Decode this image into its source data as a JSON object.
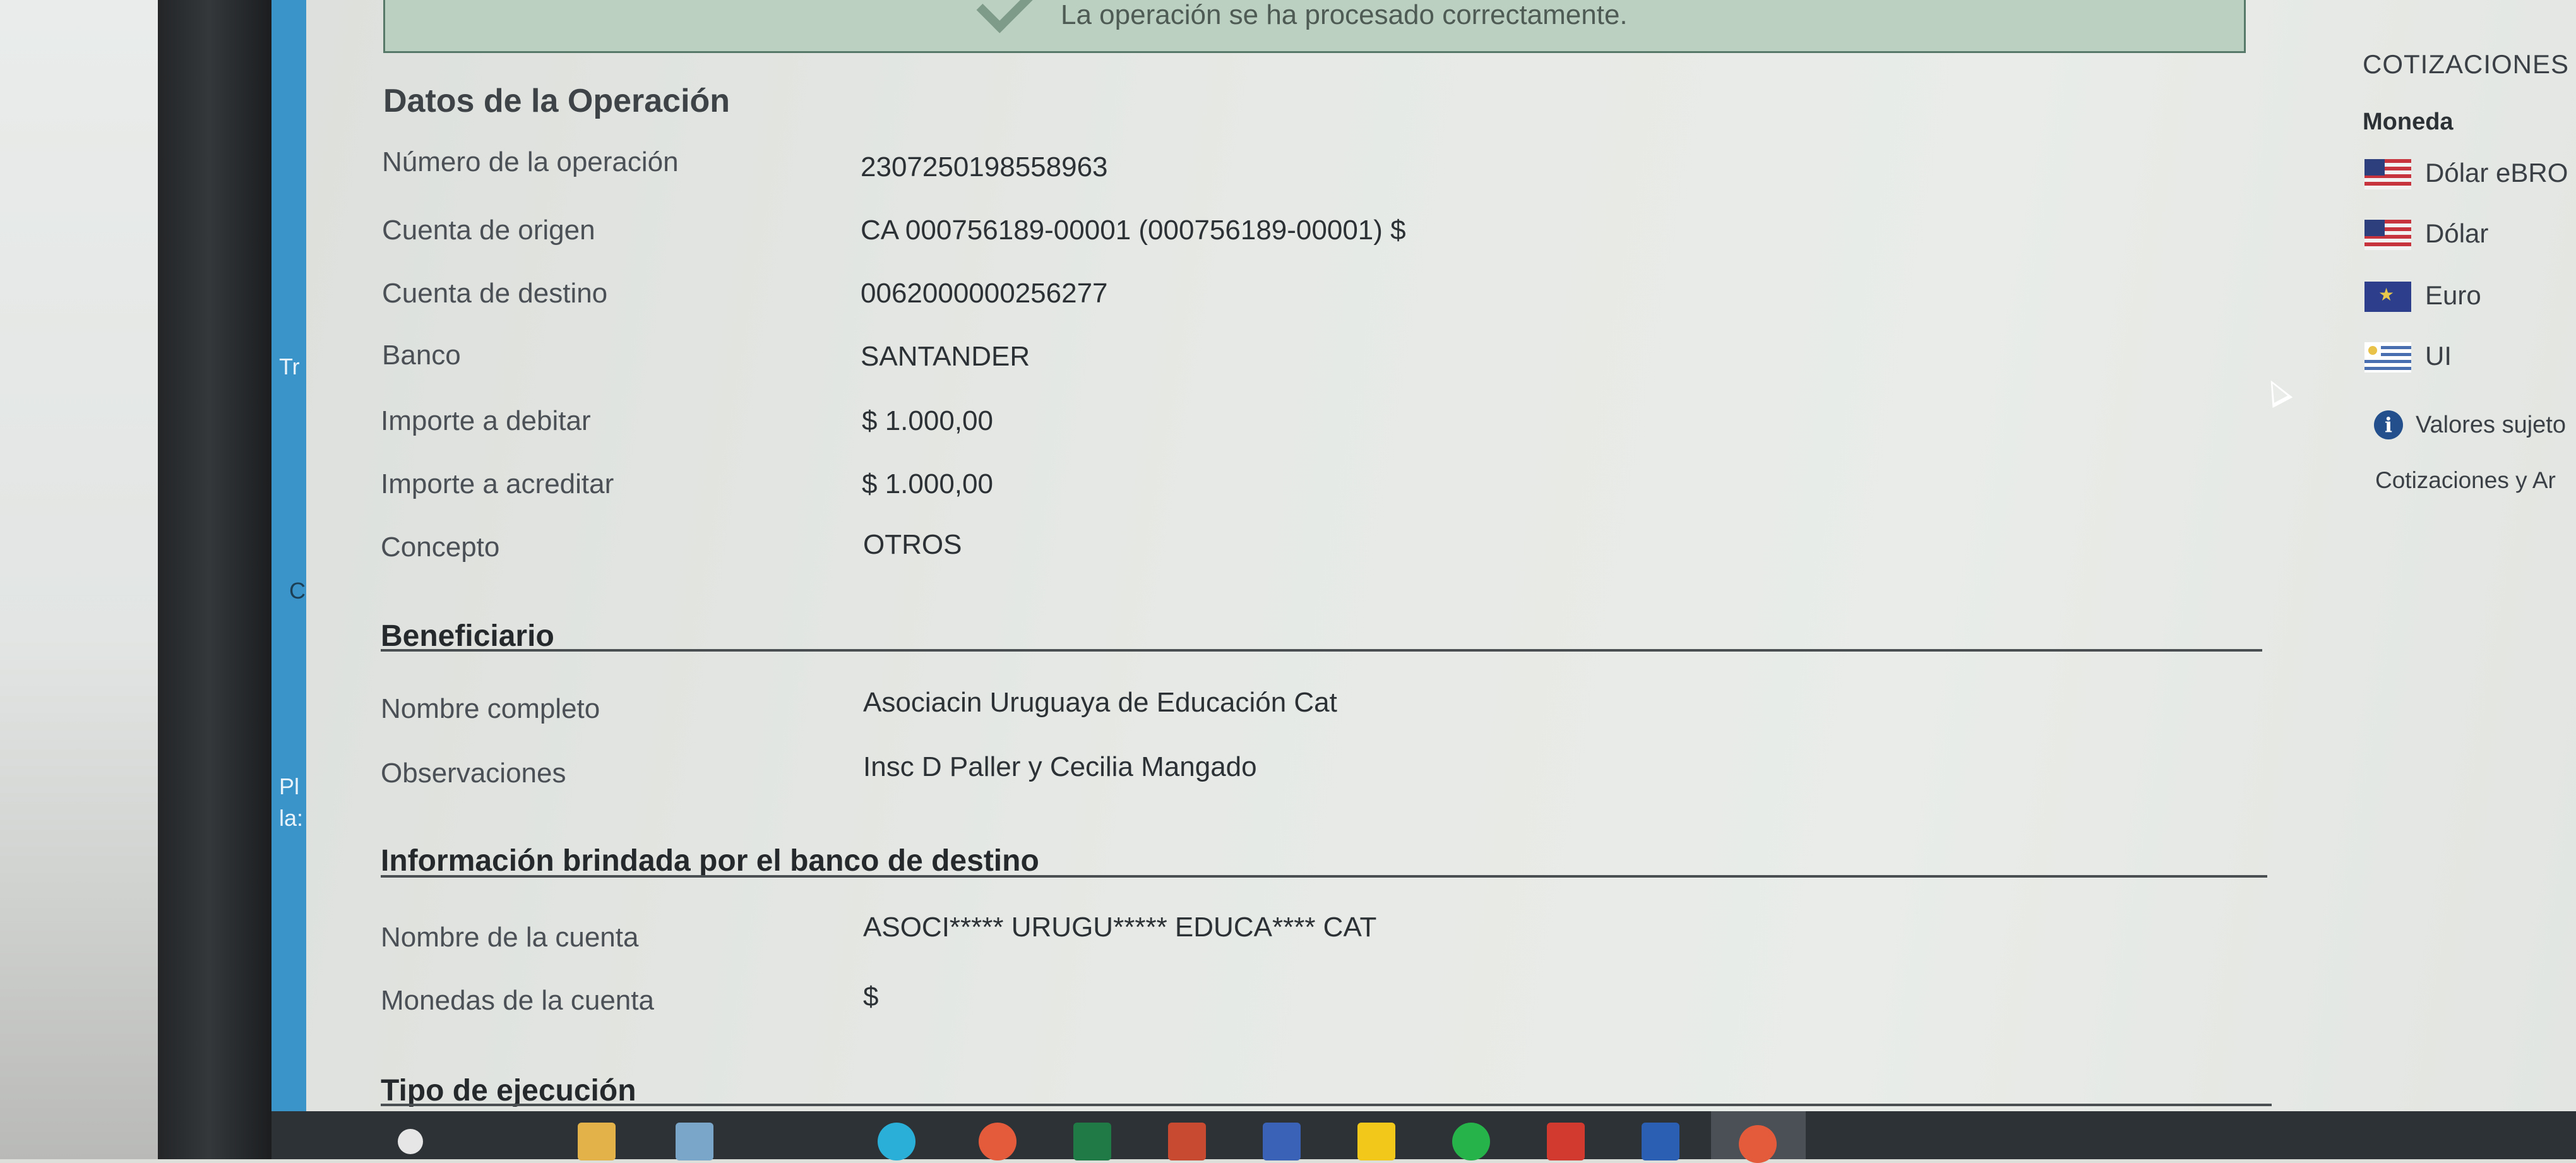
{
  "alert": {
    "message": "La operación se ha procesado correctamente."
  },
  "operation": {
    "title": "Datos de la Operación",
    "rows": [
      {
        "label": "Número de la operación",
        "value": "2307250198558963"
      },
      {
        "label": "Cuenta de origen",
        "value": "CA 000756189-00001 (000756189-00001) $"
      },
      {
        "label": "Cuenta de destino",
        "value": "0062000000256277"
      },
      {
        "label": "Banco",
        "value": "SANTANDER"
      },
      {
        "label": "Importe a debitar",
        "value": "$ 1.000,00"
      },
      {
        "label": "Importe a acreditar",
        "value": "$ 1.000,00"
      },
      {
        "label": "Concepto",
        "value": "OTROS"
      }
    ]
  },
  "beneficiary": {
    "title": "Beneficiario",
    "rows": [
      {
        "label": "Nombre completo",
        "value": "Asociacin Uruguaya de Educación Cat"
      },
      {
        "label": "Observaciones",
        "value": "Insc D Paller y Cecilia Mangado"
      }
    ]
  },
  "destination_bank": {
    "title": "Información brindada por el banco de destino",
    "rows": [
      {
        "label": "Nombre de la cuenta",
        "value": "ASOCI***** URUGU***** EDUCA**** CAT"
      },
      {
        "label": "Monedas de la cuenta",
        "value": "$"
      }
    ]
  },
  "execution": {
    "title": "Tipo de ejecución"
  },
  "sidebar": {
    "title": "COTIZACIONES",
    "header": "Moneda",
    "currencies": [
      {
        "name": "Dólar eBRO",
        "flag": "us-flag-icon"
      },
      {
        "name": "Dólar",
        "flag": "us-flag-icon"
      },
      {
        "name": "Euro",
        "flag": "eu-flag-icon"
      },
      {
        "name": "UI",
        "flag": "uy-flag-icon"
      }
    ],
    "note": "Valores sujeto",
    "link": "Cotizaciones y Ar"
  },
  "left_fragments": {
    "f1": "Tr",
    "f2": "Pl",
    "f3": "la:",
    "f4": "C"
  },
  "colors": {
    "alert_bg": "#bcd0c2",
    "alert_border": "#57796a",
    "accent_blue": "#23508c"
  }
}
